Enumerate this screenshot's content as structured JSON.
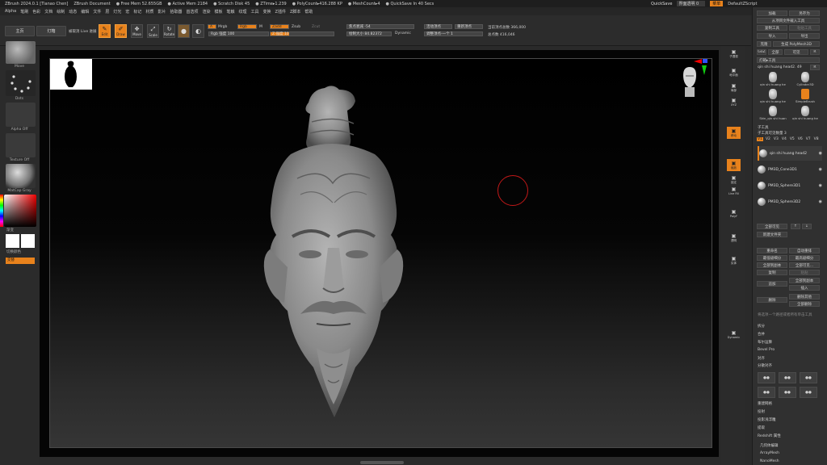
{
  "titlebar": {
    "app": "ZBrush 2024.0.1 [Tianao Chen]",
    "document": "ZBrush Document",
    "free_mem": "Free Mem 52.655GB",
    "active_mem": "Active Mem 2184",
    "scratch_disk": "Scratch Disk 45",
    "ztime": "ZTime▸1.239",
    "polycount": "PolyCount▸416.288 KP",
    "meshcount": "MeshCount▸4",
    "quicksave": "QuickSave In 40 Secs",
    "quicksave_btn": "QuickSave",
    "transparency": "界面透明 0",
    "menus_btn": "菜单",
    "script": "DefaultZScript"
  },
  "menubar": [
    "Alpha",
    "笔刷",
    "色彩",
    "文档",
    "绘制",
    "动态",
    "编辑",
    "文件",
    "层",
    "灯光",
    "宏",
    "标记",
    "材质",
    "影片",
    "拾取器",
    "首选项",
    "渲染",
    "模板",
    "笔触",
    "纹理",
    "工具",
    "变换",
    "Z插件",
    "Z脚本",
    "帮助"
  ],
  "shelf": {
    "light_box": "主页",
    "lightbox2": "灯箱",
    "spotlight": "被取消 Live 进展",
    "tool_icons": [
      {
        "label": "Edit",
        "icon": "edit-icon",
        "on": true
      },
      {
        "label": "Draw",
        "icon": "draw-icon",
        "on": true
      },
      {
        "label": "Move",
        "icon": "move-icon",
        "on": false
      },
      {
        "label": "Scale",
        "icon": "scale-icon",
        "on": false
      },
      {
        "label": "Rotate",
        "icon": "rotate-icon",
        "on": false
      }
    ],
    "mrgb": "Mrgb",
    "a_label": "A",
    "rgb": "Rgb",
    "m": "M",
    "zadd": "Zadd",
    "zsub": "Zsub",
    "zcut": "Zcut",
    "rgb_intensity": "Rgb 强度 100",
    "z_intensity": "Z 强度 10",
    "focal_shift": "焦点衰减 -54",
    "draw_size": "绘制大小 84.82372",
    "dynamic": "Dynamic",
    "active_points": "活动顶点",
    "total_points": "重新顶点",
    "lazy": "调整顶点-一个 1",
    "active_count": "当前顶点总数 366,000",
    "total_count": "总点数 416,046"
  },
  "lefttray": {
    "brush": "Move",
    "stroke": "Dots",
    "alpha": "Alpha Off",
    "texture": "Texture Off",
    "material": "MatCap Gray",
    "color_label": "渐变",
    "swatch_label": "切换颜色",
    "alt_btn": "交替"
  },
  "rightbar": [
    {
      "label": "子透视",
      "icon": "perspective-icon",
      "on": false
    },
    {
      "label": "地平面",
      "icon": "floor-icon",
      "on": false
    },
    {
      "label": "局部",
      "icon": "local-icon",
      "on": false
    },
    {
      "label": "XYZ",
      "icon": "xyz-icon",
      "on": false
    },
    {
      "label": "移动",
      "icon": "move-icon",
      "on": true
    },
    {
      "label": "缩放",
      "icon": "scale-icon",
      "on": true
    },
    {
      "label": "锁定",
      "icon": "lock-icon",
      "on": false
    },
    {
      "label": "Line Fill",
      "icon": "linefill-icon",
      "on": false
    },
    {
      "label": "PolyF",
      "icon": "polyf-icon",
      "on": false
    },
    {
      "label": "透明",
      "icon": "transp-icon",
      "on": false
    },
    {
      "label": "实体",
      "icon": "solo-icon",
      "on": false
    },
    {
      "label": "Dynamic",
      "icon": "dynamic-icon",
      "on": false
    }
  ],
  "rightpanel": {
    "load": "加载",
    "save_as": "另存为",
    "import_tool": "从项目文件载入工具",
    "copy_tool": "复制工具",
    "paste_tool": "粘贴工具",
    "import": "导入",
    "export": "导出",
    "clone": "克隆",
    "make_polymesh": "生成 PolyMesh3D",
    "goz": "GoZ",
    "all": "全部",
    "visible": "可见",
    "r": "R",
    "lightbox_tools": "灯箱▸工具",
    "current_tool": "qin shi huang head2. 49",
    "r2": "R",
    "tools": [
      "qin shi huang he",
      "Cylinder3D",
      "qin shi huang he",
      "SimpleBrush",
      "Skin_qin shi huan",
      "qin shi huang he"
    ],
    "subtool_title": "子工具",
    "subtool_count": "子工具可见数量 3",
    "v_tabs": [
      "V1",
      "V2",
      "V3",
      "V4",
      "V5",
      "V6",
      "V7",
      "V8"
    ],
    "subtools": [
      "qin shi huang head2",
      "PM3D_Cone3D1",
      "PM3D_Sphere3D1",
      "PM3D_Sphere3D2"
    ],
    "list_all": "全部可见",
    "new_folder": "新建文件夹",
    "rename": "重命名",
    "auto_reorder": "自动重排",
    "all_low": "最低级细分",
    "all_high": "最高级细分",
    "dup": "全部到副本",
    "all_unsmooth": "全部可见...",
    "copy": "复制",
    "paste": "粘贴",
    "append": "追加",
    "insert": "插入",
    "delete": "删除",
    "del_other": "删除其他",
    "del_all": "全部删除",
    "note": "将选项—个路径或者所有单击工具",
    "split": "拆分",
    "merge": "合并",
    "boolean": "布尔运算",
    "bevel_pro": "Bevel Pro",
    "align": "对齐",
    "distribute": "分散对齐",
    "remesh": "重建网格",
    "project": "投射",
    "project_bas": "投影浅浮雕",
    "extract": "提取",
    "redshift": "Redshift 属性",
    "geometry": "几何体编辑",
    "arraymesh": "ArrayMesh",
    "nanomesh": "NanoMesh"
  },
  "colors": {
    "accent": "#e8821c",
    "bg": "#2a2a2a",
    "canvas": "#050505"
  }
}
